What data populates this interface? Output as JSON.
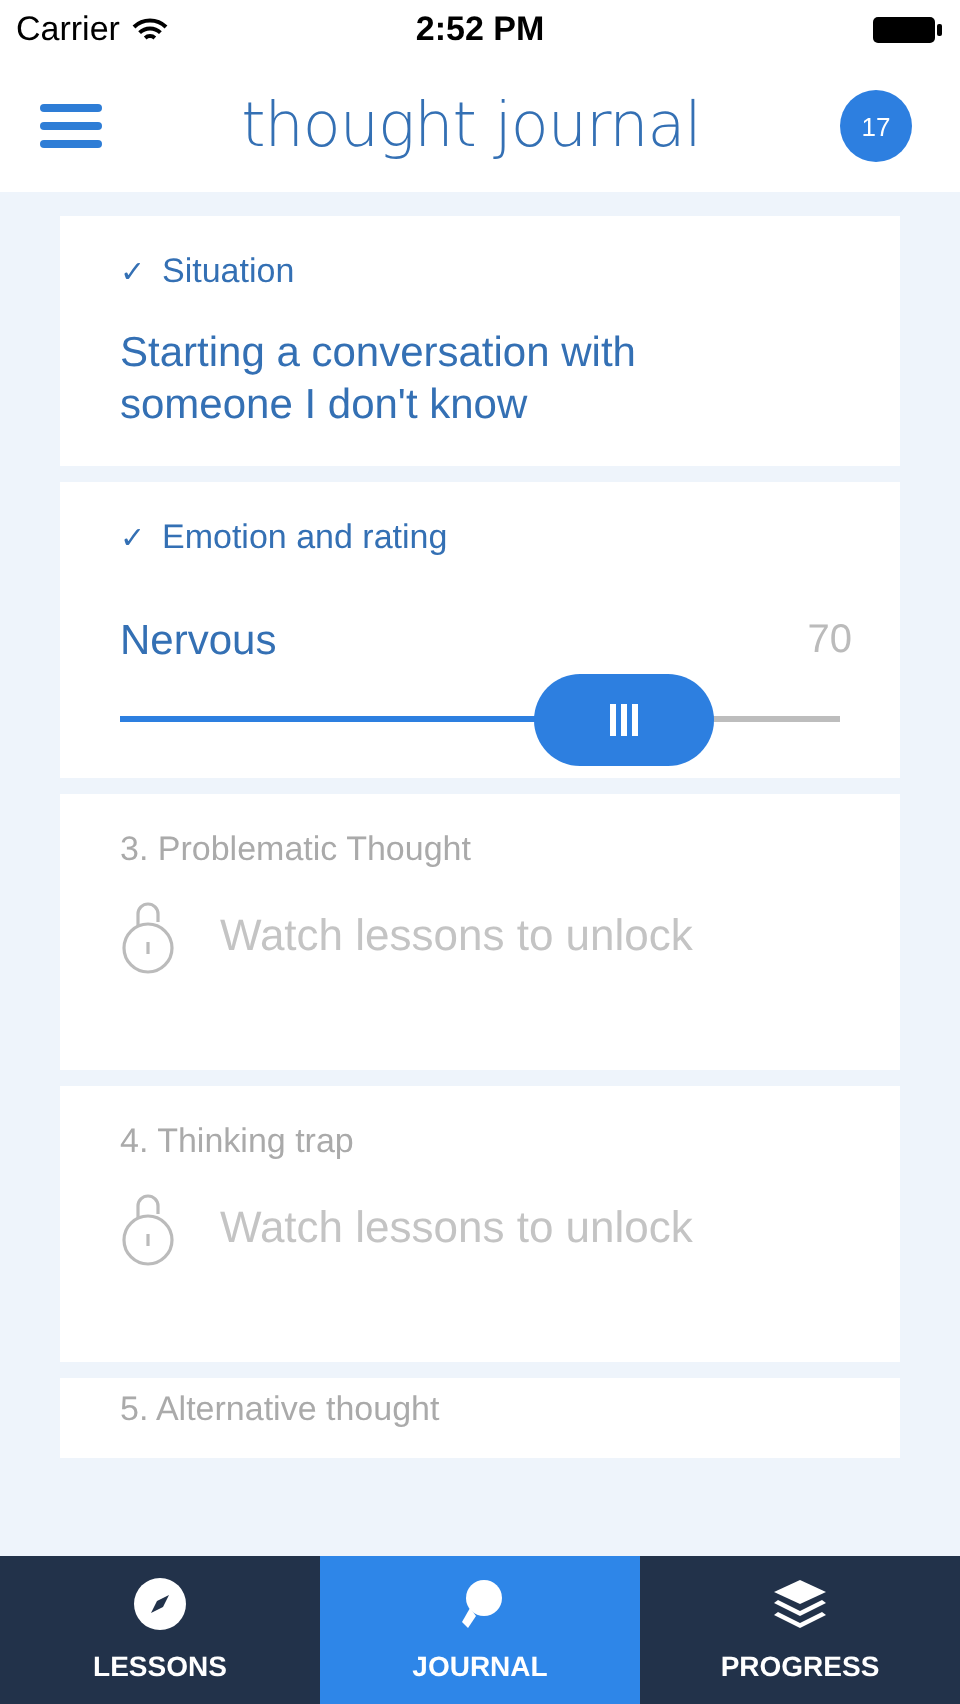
{
  "status_bar": {
    "carrier": "Carrier",
    "time": "2:52 PM"
  },
  "nav": {
    "title": "thought journal",
    "badge": "17"
  },
  "sections": [
    {
      "kind": "answer",
      "done": true,
      "mark": "✓",
      "title": "Situation",
      "text": "Starting a conversation with someone I don't know"
    },
    {
      "kind": "rating",
      "done": true,
      "mark": "✓",
      "title": "Emotion and rating",
      "emotion": "Nervous",
      "reading": "70",
      "level": 0.7
    },
    {
      "kind": "locked",
      "done": false,
      "title": "3. Problematic Thought",
      "text": "Watch lessons to unlock"
    },
    {
      "kind": "locked",
      "done": false,
      "title": "4. Thinking trap",
      "text": "Watch lessons to unlock"
    },
    {
      "kind": "header",
      "done": false,
      "title": "5. Alternative thought"
    }
  ],
  "tabs": [
    {
      "label": "LESSONS",
      "selected": false
    },
    {
      "label": "JOURNAL",
      "selected": true
    },
    {
      "label": "PROGRESS",
      "selected": false
    }
  ]
}
